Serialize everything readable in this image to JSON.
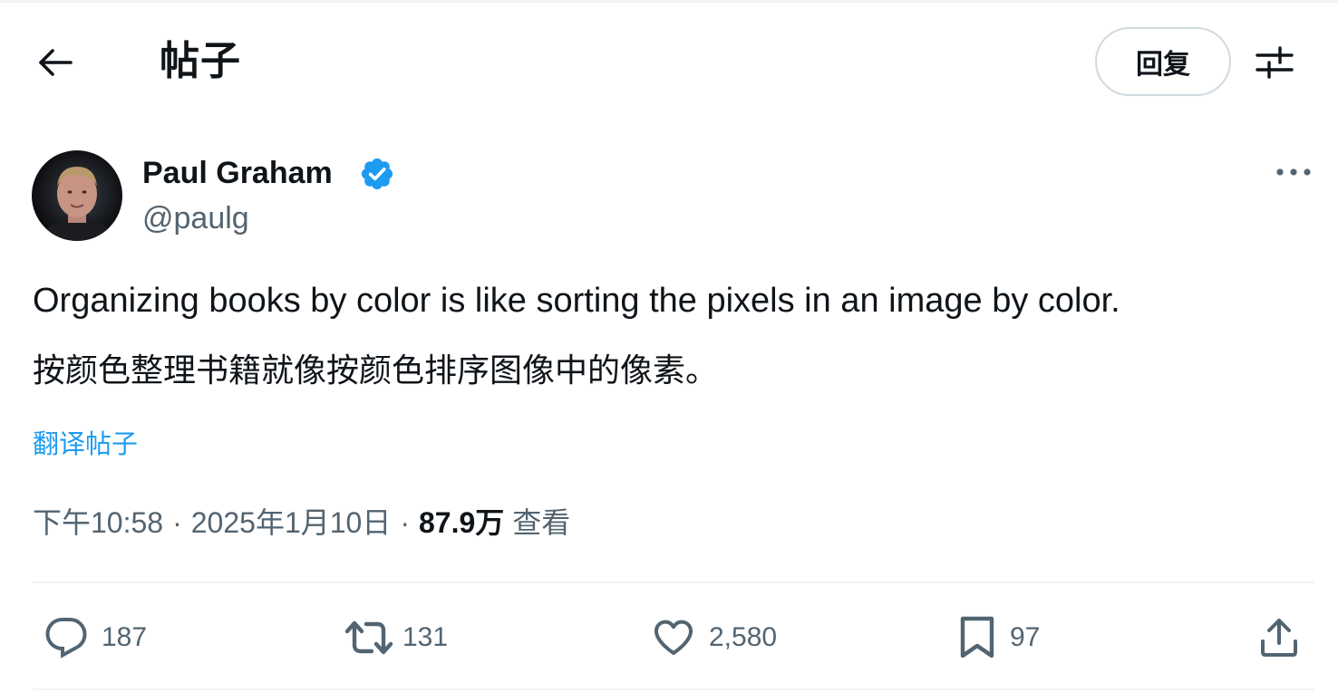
{
  "header": {
    "title": "帖子",
    "reply_label": "回复"
  },
  "author": {
    "name": "Paul Graham",
    "handle": "@paulg",
    "verified": true
  },
  "tweet": {
    "text": "Organizing books by color is like sorting the pixels in an image by color.",
    "text_cn": "按颜色整理书籍就像按颜色排序图像中的像素。",
    "translate_label": "翻译帖子"
  },
  "meta": {
    "time": "下午10:58",
    "date": "2025年1月10日",
    "separator": "·",
    "views_count": "87.9万",
    "views_label": "查看"
  },
  "actions": {
    "replies": "187",
    "retweets": "131",
    "likes": "2,580",
    "bookmarks": "97"
  },
  "colors": {
    "accent": "#1d9bf0",
    "text_primary": "#0f1419",
    "text_secondary": "#536471",
    "border": "#cfd9de"
  },
  "icons": {
    "back": "arrow-left-icon",
    "filter": "sliders-icon",
    "more": "more-horizontal-icon",
    "verified": "verified-badge-icon",
    "reply": "chat-bubble-icon",
    "retweet": "retweet-icon",
    "like": "heart-icon",
    "bookmark": "bookmark-icon",
    "share": "share-icon"
  }
}
